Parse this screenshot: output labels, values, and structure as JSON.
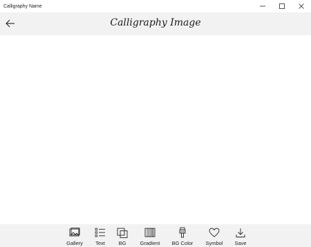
{
  "window": {
    "title": "Calligraphy Name"
  },
  "header": {
    "title": "Calligraphy Image"
  },
  "toolbar": {
    "items": [
      {
        "label": "Gallery",
        "icon": "gallery-icon"
      },
      {
        "label": "Text",
        "icon": "list-text-icon"
      },
      {
        "label": "BG",
        "icon": "layers-icon"
      },
      {
        "label": "Gradient",
        "icon": "gradient-icon"
      },
      {
        "label": "BG Color",
        "icon": "paint-bucket-icon"
      },
      {
        "label": "Symbol",
        "icon": "heart-icon"
      },
      {
        "label": "Save",
        "icon": "download-icon"
      }
    ]
  },
  "colors": {
    "header_bg": "#f2f2f2",
    "toolbar_bg": "#f2f2f2",
    "canvas_bg": "#ffffff"
  }
}
